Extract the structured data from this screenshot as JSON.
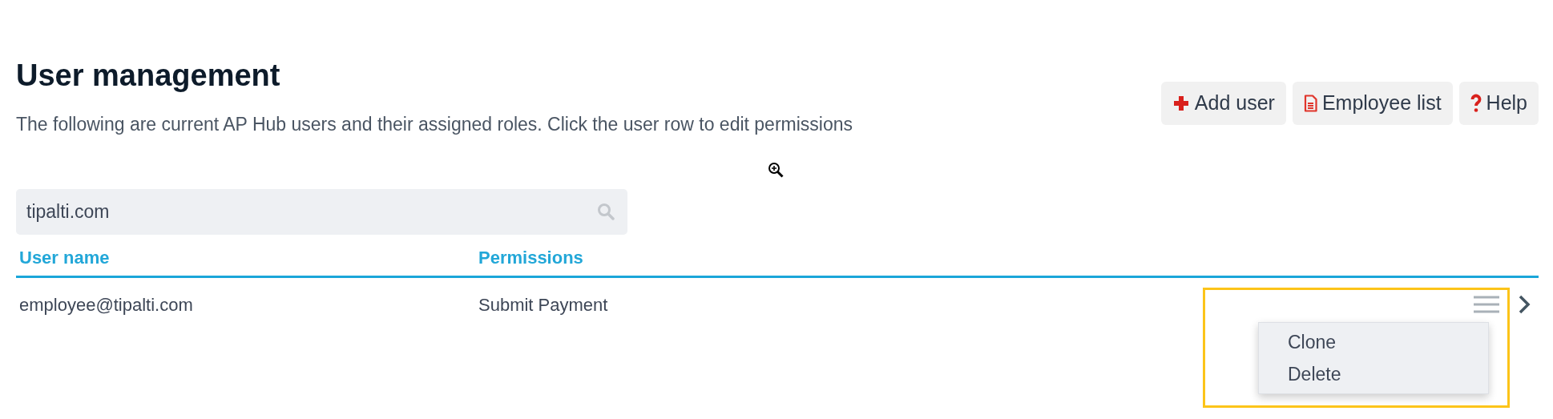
{
  "page": {
    "title": "User management",
    "description": "The following are current AP Hub users and their assigned roles. Click the user row to edit permissions"
  },
  "buttons": [
    {
      "label": "Add user",
      "kind": "add"
    },
    {
      "label": "Employee list",
      "kind": "document"
    },
    {
      "label": "Help",
      "kind": "help"
    }
  ],
  "search": {
    "value": "tipalti.com"
  },
  "table": {
    "columns": [
      "User name",
      "Permissions"
    ],
    "rows": [
      {
        "cells": [
          "employee@tipalti.com",
          "Submit Payment"
        ],
        "menu_open": true
      }
    ]
  },
  "row_menu": {
    "items": [
      "Clone",
      "Delete"
    ]
  }
}
